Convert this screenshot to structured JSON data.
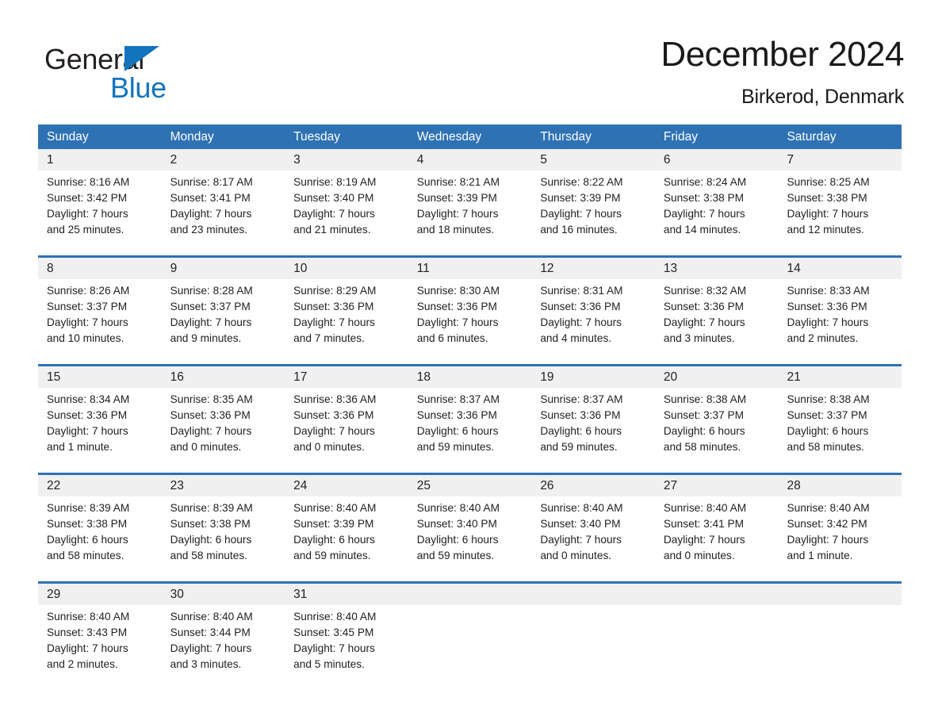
{
  "branding": {
    "logo_text_1": "General",
    "logo_text_2": "Blue",
    "logo_icon": "triangle-icon",
    "accent_color": "#1274bc"
  },
  "header": {
    "title": "December 2024",
    "subtitle": "Birkerod, Denmark"
  },
  "colors": {
    "header_blue": "#2e72b4",
    "daynum_band": "#f0f0f0",
    "text": "#1f1f1f"
  },
  "weekday_headers": [
    "Sunday",
    "Monday",
    "Tuesday",
    "Wednesday",
    "Thursday",
    "Friday",
    "Saturday"
  ],
  "weeks": [
    [
      {
        "day": "1",
        "sunrise": "Sunrise: 8:16 AM",
        "sunset": "Sunset: 3:42 PM",
        "daylight_1": "Daylight: 7 hours",
        "daylight_2": "and 25 minutes."
      },
      {
        "day": "2",
        "sunrise": "Sunrise: 8:17 AM",
        "sunset": "Sunset: 3:41 PM",
        "daylight_1": "Daylight: 7 hours",
        "daylight_2": "and 23 minutes."
      },
      {
        "day": "3",
        "sunrise": "Sunrise: 8:19 AM",
        "sunset": "Sunset: 3:40 PM",
        "daylight_1": "Daylight: 7 hours",
        "daylight_2": "and 21 minutes."
      },
      {
        "day": "4",
        "sunrise": "Sunrise: 8:21 AM",
        "sunset": "Sunset: 3:39 PM",
        "daylight_1": "Daylight: 7 hours",
        "daylight_2": "and 18 minutes."
      },
      {
        "day": "5",
        "sunrise": "Sunrise: 8:22 AM",
        "sunset": "Sunset: 3:39 PM",
        "daylight_1": "Daylight: 7 hours",
        "daylight_2": "and 16 minutes."
      },
      {
        "day": "6",
        "sunrise": "Sunrise: 8:24 AM",
        "sunset": "Sunset: 3:38 PM",
        "daylight_1": "Daylight: 7 hours",
        "daylight_2": "and 14 minutes."
      },
      {
        "day": "7",
        "sunrise": "Sunrise: 8:25 AM",
        "sunset": "Sunset: 3:38 PM",
        "daylight_1": "Daylight: 7 hours",
        "daylight_2": "and 12 minutes."
      }
    ],
    [
      {
        "day": "8",
        "sunrise": "Sunrise: 8:26 AM",
        "sunset": "Sunset: 3:37 PM",
        "daylight_1": "Daylight: 7 hours",
        "daylight_2": "and 10 minutes."
      },
      {
        "day": "9",
        "sunrise": "Sunrise: 8:28 AM",
        "sunset": "Sunset: 3:37 PM",
        "daylight_1": "Daylight: 7 hours",
        "daylight_2": "and 9 minutes."
      },
      {
        "day": "10",
        "sunrise": "Sunrise: 8:29 AM",
        "sunset": "Sunset: 3:36 PM",
        "daylight_1": "Daylight: 7 hours",
        "daylight_2": "and 7 minutes."
      },
      {
        "day": "11",
        "sunrise": "Sunrise: 8:30 AM",
        "sunset": "Sunset: 3:36 PM",
        "daylight_1": "Daylight: 7 hours",
        "daylight_2": "and 6 minutes."
      },
      {
        "day": "12",
        "sunrise": "Sunrise: 8:31 AM",
        "sunset": "Sunset: 3:36 PM",
        "daylight_1": "Daylight: 7 hours",
        "daylight_2": "and 4 minutes."
      },
      {
        "day": "13",
        "sunrise": "Sunrise: 8:32 AM",
        "sunset": "Sunset: 3:36 PM",
        "daylight_1": "Daylight: 7 hours",
        "daylight_2": "and 3 minutes."
      },
      {
        "day": "14",
        "sunrise": "Sunrise: 8:33 AM",
        "sunset": "Sunset: 3:36 PM",
        "daylight_1": "Daylight: 7 hours",
        "daylight_2": "and 2 minutes."
      }
    ],
    [
      {
        "day": "15",
        "sunrise": "Sunrise: 8:34 AM",
        "sunset": "Sunset: 3:36 PM",
        "daylight_1": "Daylight: 7 hours",
        "daylight_2": "and 1 minute."
      },
      {
        "day": "16",
        "sunrise": "Sunrise: 8:35 AM",
        "sunset": "Sunset: 3:36 PM",
        "daylight_1": "Daylight: 7 hours",
        "daylight_2": "and 0 minutes."
      },
      {
        "day": "17",
        "sunrise": "Sunrise: 8:36 AM",
        "sunset": "Sunset: 3:36 PM",
        "daylight_1": "Daylight: 7 hours",
        "daylight_2": "and 0 minutes."
      },
      {
        "day": "18",
        "sunrise": "Sunrise: 8:37 AM",
        "sunset": "Sunset: 3:36 PM",
        "daylight_1": "Daylight: 6 hours",
        "daylight_2": "and 59 minutes."
      },
      {
        "day": "19",
        "sunrise": "Sunrise: 8:37 AM",
        "sunset": "Sunset: 3:36 PM",
        "daylight_1": "Daylight: 6 hours",
        "daylight_2": "and 59 minutes."
      },
      {
        "day": "20",
        "sunrise": "Sunrise: 8:38 AM",
        "sunset": "Sunset: 3:37 PM",
        "daylight_1": "Daylight: 6 hours",
        "daylight_2": "and 58 minutes."
      },
      {
        "day": "21",
        "sunrise": "Sunrise: 8:38 AM",
        "sunset": "Sunset: 3:37 PM",
        "daylight_1": "Daylight: 6 hours",
        "daylight_2": "and 58 minutes."
      }
    ],
    [
      {
        "day": "22",
        "sunrise": "Sunrise: 8:39 AM",
        "sunset": "Sunset: 3:38 PM",
        "daylight_1": "Daylight: 6 hours",
        "daylight_2": "and 58 minutes."
      },
      {
        "day": "23",
        "sunrise": "Sunrise: 8:39 AM",
        "sunset": "Sunset: 3:38 PM",
        "daylight_1": "Daylight: 6 hours",
        "daylight_2": "and 58 minutes."
      },
      {
        "day": "24",
        "sunrise": "Sunrise: 8:40 AM",
        "sunset": "Sunset: 3:39 PM",
        "daylight_1": "Daylight: 6 hours",
        "daylight_2": "and 59 minutes."
      },
      {
        "day": "25",
        "sunrise": "Sunrise: 8:40 AM",
        "sunset": "Sunset: 3:40 PM",
        "daylight_1": "Daylight: 6 hours",
        "daylight_2": "and 59 minutes."
      },
      {
        "day": "26",
        "sunrise": "Sunrise: 8:40 AM",
        "sunset": "Sunset: 3:40 PM",
        "daylight_1": "Daylight: 7 hours",
        "daylight_2": "and 0 minutes."
      },
      {
        "day": "27",
        "sunrise": "Sunrise: 8:40 AM",
        "sunset": "Sunset: 3:41 PM",
        "daylight_1": "Daylight: 7 hours",
        "daylight_2": "and 0 minutes."
      },
      {
        "day": "28",
        "sunrise": "Sunrise: 8:40 AM",
        "sunset": "Sunset: 3:42 PM",
        "daylight_1": "Daylight: 7 hours",
        "daylight_2": "and 1 minute."
      }
    ],
    [
      {
        "day": "29",
        "sunrise": "Sunrise: 8:40 AM",
        "sunset": "Sunset: 3:43 PM",
        "daylight_1": "Daylight: 7 hours",
        "daylight_2": "and 2 minutes."
      },
      {
        "day": "30",
        "sunrise": "Sunrise: 8:40 AM",
        "sunset": "Sunset: 3:44 PM",
        "daylight_1": "Daylight: 7 hours",
        "daylight_2": "and 3 minutes."
      },
      {
        "day": "31",
        "sunrise": "Sunrise: 8:40 AM",
        "sunset": "Sunset: 3:45 PM",
        "daylight_1": "Daylight: 7 hours",
        "daylight_2": "and 5 minutes."
      },
      {
        "day": "",
        "sunrise": "",
        "sunset": "",
        "daylight_1": "",
        "daylight_2": ""
      },
      {
        "day": "",
        "sunrise": "",
        "sunset": "",
        "daylight_1": "",
        "daylight_2": ""
      },
      {
        "day": "",
        "sunrise": "",
        "sunset": "",
        "daylight_1": "",
        "daylight_2": ""
      },
      {
        "day": "",
        "sunrise": "",
        "sunset": "",
        "daylight_1": "",
        "daylight_2": ""
      }
    ]
  ]
}
